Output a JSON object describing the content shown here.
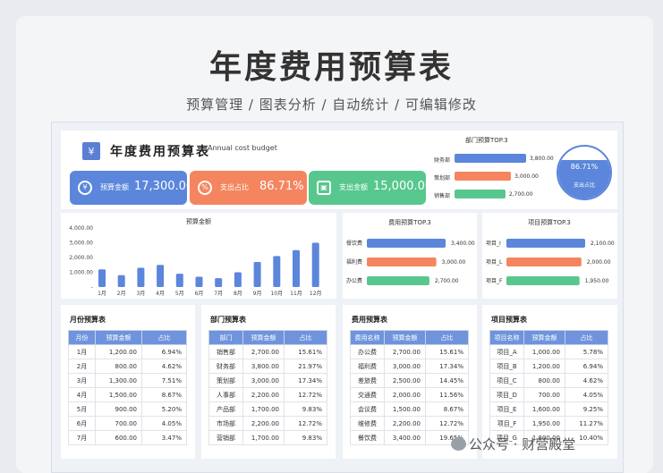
{
  "hero": {
    "title": "年度费用预算表",
    "subtitle": "预算管理 / 图表分析 / 自动统计 / 可编辑修改"
  },
  "header": {
    "title": "年度费用预算表",
    "subtitle": "Annual cost budget",
    "logo": "¥"
  },
  "kpis": [
    {
      "icon": "budget-coin-icon",
      "label": "预算金额",
      "value": "17,300.00",
      "color": "#5b86db"
    },
    {
      "icon": "percent-icon",
      "label": "支出占比",
      "value": "86.71%",
      "color": "#f5855f"
    },
    {
      "icon": "wallet-icon",
      "label": "支出金额",
      "value": "15,000.00",
      "color": "#58c78e"
    }
  ],
  "gauge": {
    "value": "86.71%",
    "label": "支出占比",
    "fill": 0.8671
  },
  "dept_top": {
    "title": "部门预算TOP.3",
    "items": [
      {
        "label": "财务部",
        "value": "3,800.00",
        "color": "#5b86db"
      },
      {
        "label": "策划部",
        "value": "3,000.00",
        "color": "#f5855f"
      },
      {
        "label": "销售部",
        "value": "2,700.00",
        "color": "#58c78e"
      }
    ]
  },
  "chart_data": [
    {
      "type": "bar",
      "title": "预算金额",
      "categories": [
        "1月",
        "2月",
        "3月",
        "4月",
        "5月",
        "6月",
        "7月",
        "8月",
        "9月",
        "10月",
        "11月",
        "12月"
      ],
      "values": [
        1200,
        800,
        1300,
        1500,
        900,
        700,
        600,
        1000,
        1700,
        2100,
        2500,
        3000
      ],
      "yticks": [
        "4,000.00",
        "3,000.00",
        "2,000.00",
        "1,000.00",
        "-"
      ],
      "ylim": [
        0,
        4000
      ],
      "color": "#5b86db"
    },
    {
      "type": "bar",
      "title": "费用预算TOP.3",
      "categories": [
        "餐饮费",
        "福利费",
        "办公费"
      ],
      "values": [
        3400,
        3000,
        2700
      ],
      "value_labels": [
        "3,400.00",
        "3,000.00",
        "2,700.00"
      ],
      "colors": [
        "#5b86db",
        "#f5855f",
        "#58c78e"
      ]
    },
    {
      "type": "bar",
      "title": "项目预算TOP.3",
      "categories": [
        "项目_I",
        "项目_L",
        "项目_F"
      ],
      "values": [
        2100,
        2000,
        1950
      ],
      "value_labels": [
        "2,100.00",
        "2,000.00",
        "1,950.00"
      ],
      "colors": [
        "#5b86db",
        "#f5855f",
        "#58c78e"
      ]
    }
  ],
  "tables": [
    {
      "title": "月份预算表",
      "headers": [
        "月份",
        "预算金额",
        "占比"
      ],
      "rows": [
        [
          "1月",
          "1,200.00",
          "6.94%"
        ],
        [
          "2月",
          "800.00",
          "4.62%"
        ],
        [
          "3月",
          "1,300.00",
          "7.51%"
        ],
        [
          "4月",
          "1,500.00",
          "8.67%"
        ],
        [
          "5月",
          "900.00",
          "5.20%"
        ],
        [
          "6月",
          "700.00",
          "4.05%"
        ],
        [
          "7月",
          "600.00",
          "3.47%"
        ]
      ]
    },
    {
      "title": "部门预算表",
      "headers": [
        "部门",
        "预算金额",
        "占比"
      ],
      "rows": [
        [
          "销售部",
          "2,700.00",
          "15.61%"
        ],
        [
          "财务部",
          "3,800.00",
          "21.97%"
        ],
        [
          "策划部",
          "3,000.00",
          "17.34%"
        ],
        [
          "人事部",
          "2,200.00",
          "12.72%"
        ],
        [
          "产品部",
          "1,700.00",
          "9.83%"
        ],
        [
          "市场部",
          "2,200.00",
          "12.72%"
        ],
        [
          "营销部",
          "1,700.00",
          "9.83%"
        ]
      ]
    },
    {
      "title": "费用预算表",
      "headers": [
        "费用名称",
        "预算金额",
        "占比"
      ],
      "rows": [
        [
          "办公费",
          "2,700.00",
          "15.61%"
        ],
        [
          "福利费",
          "3,000.00",
          "17.34%"
        ],
        [
          "差旅费",
          "2,500.00",
          "14.45%"
        ],
        [
          "交通费",
          "2,000.00",
          "11.56%"
        ],
        [
          "会议费",
          "1,500.00",
          "8.67%"
        ],
        [
          "维修费",
          "2,200.00",
          "12.72%"
        ],
        [
          "餐饮费",
          "3,400.00",
          "19.65%"
        ]
      ]
    },
    {
      "title": "项目预算表",
      "headers": [
        "项目名称",
        "预算金额",
        "占比"
      ],
      "rows": [
        [
          "项目_A",
          "1,000.00",
          "5.78%"
        ],
        [
          "项目_B",
          "1,200.00",
          "6.94%"
        ],
        [
          "项目_C",
          "800.00",
          "4.62%"
        ],
        [
          "项目_D",
          "700.00",
          "4.05%"
        ],
        [
          "项目_E",
          "1,600.00",
          "9.25%"
        ],
        [
          "项目_F",
          "1,950.00",
          "11.27%"
        ],
        [
          "项目_G",
          "1,800.00",
          "10.40%"
        ]
      ]
    }
  ],
  "watermark": "公众号 · 财营殿堂"
}
